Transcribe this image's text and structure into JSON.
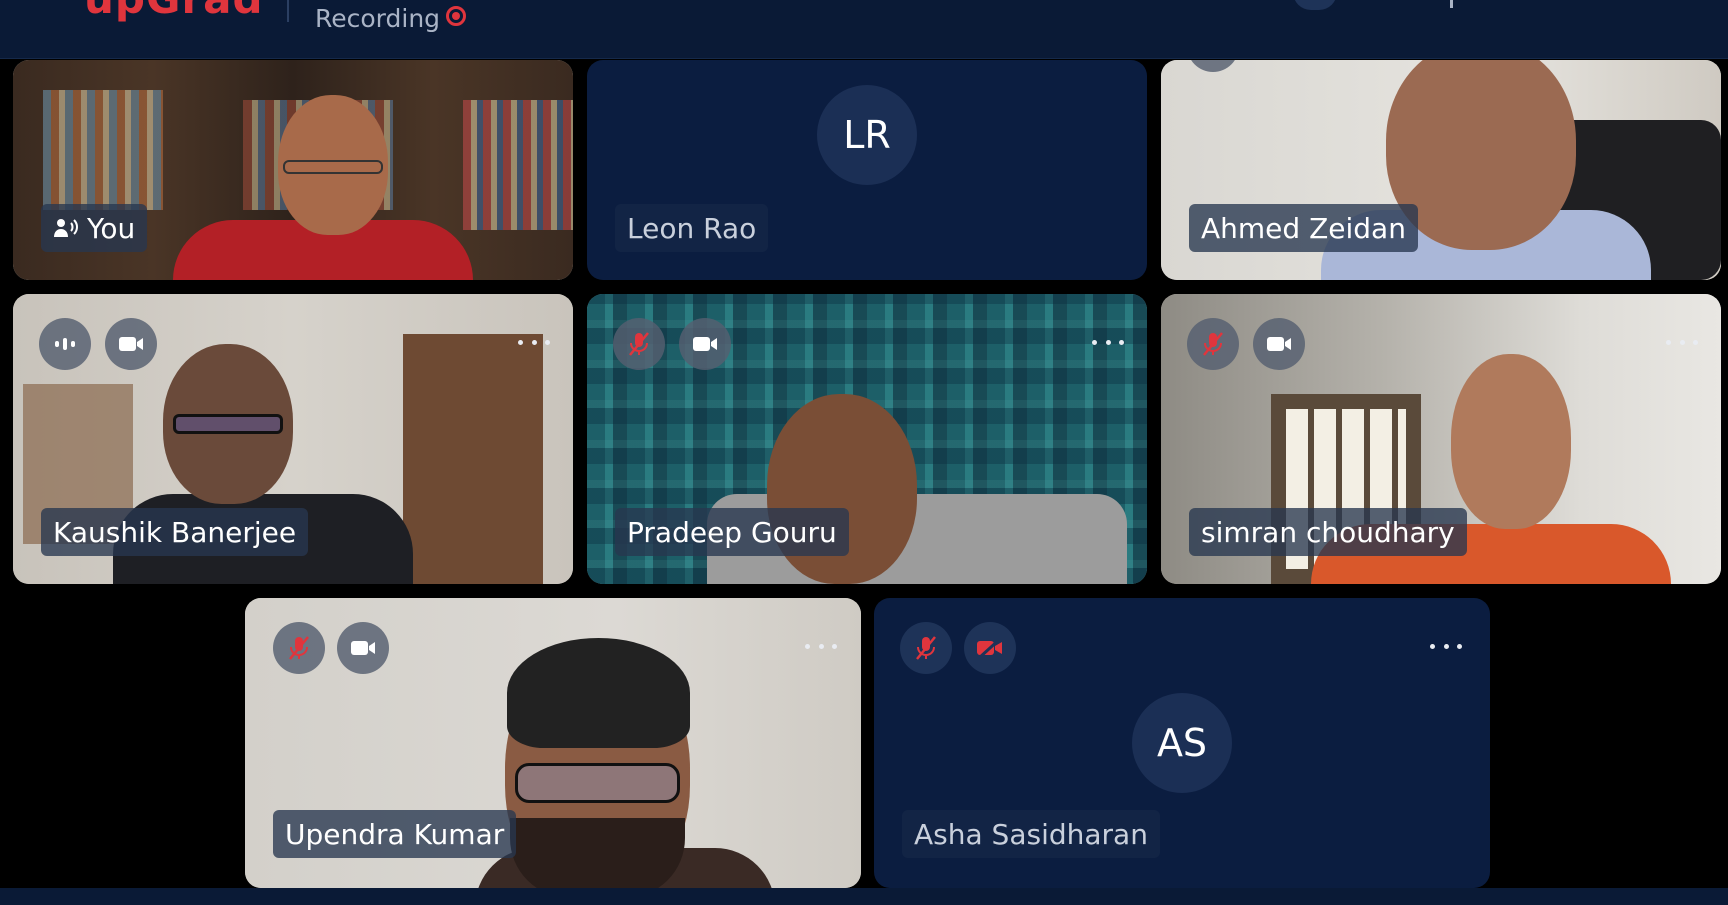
{
  "header": {
    "brand": "upGrad",
    "recording_label": "Recording"
  },
  "tiles": [
    {
      "name": "You",
      "initials": "",
      "camera": true
    },
    {
      "name": "Leon Rao",
      "initials": "LR",
      "camera": false
    },
    {
      "name": "Ahmed Zeidan",
      "initials": "",
      "camera": true
    },
    {
      "name": "Kaushik Banerjee",
      "initials": "",
      "camera": true,
      "mic": "speaking"
    },
    {
      "name": "Pradeep Gouru",
      "initials": "",
      "camera": true,
      "mic": "muted"
    },
    {
      "name": "simran choudhary",
      "initials": "",
      "camera": true,
      "mic": "muted"
    },
    {
      "name": "Upendra Kumar",
      "initials": "",
      "camera": true,
      "mic": "muted"
    },
    {
      "name": "Asha Sasidharan",
      "initials": "AS",
      "camera": false,
      "mic": "muted"
    }
  ],
  "colors": {
    "brand_red": "#e0353d",
    "topbar_bg": "#0a1a36",
    "avatar_tile_bg": "#0b1d40",
    "muted_icon": "#e0353d"
  },
  "icons": [
    "speaker-icon",
    "audio-wave-icon",
    "mic-muted-icon",
    "camera-icon",
    "camera-off-icon",
    "more-options-icon"
  ]
}
